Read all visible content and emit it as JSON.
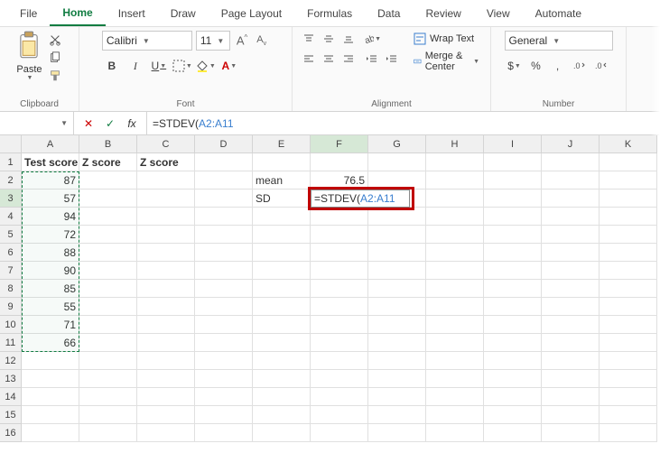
{
  "tabs": {
    "items": [
      "File",
      "Home",
      "Insert",
      "Draw",
      "Page Layout",
      "Formulas",
      "Data",
      "Review",
      "View",
      "Automate"
    ],
    "active_index": 1
  },
  "ribbon": {
    "clipboard": {
      "label": "Clipboard",
      "paste": "Paste"
    },
    "font": {
      "label": "Font",
      "name": "Calibri",
      "size": "11",
      "increase": "A",
      "decrease": "A",
      "bold": "B",
      "italic": "I",
      "underline": "U"
    },
    "alignment": {
      "label": "Alignment",
      "wrap": "Wrap Text",
      "merge": "Merge & Center"
    },
    "number": {
      "label": "Number",
      "format": "General",
      "currency": "$",
      "percent": "%",
      "comma": ","
    }
  },
  "formula_bar": {
    "name_box": "",
    "formula_prefix": "=STDEV(",
    "formula_ref": "A2:A11"
  },
  "columns": [
    "A",
    "B",
    "C",
    "D",
    "E",
    "F",
    "G",
    "H",
    "I",
    "J",
    "K"
  ],
  "rows": [
    "1",
    "2",
    "3",
    "4",
    "5",
    "6",
    "7",
    "8",
    "9",
    "10",
    "11",
    "12",
    "13",
    "14",
    "15",
    "16"
  ],
  "data": {
    "A1": "Test score",
    "B1": "Z score",
    "C1": "Z score",
    "A2": "87",
    "A3": "57",
    "A4": "94",
    "A5": "72",
    "A6": "88",
    "A7": "90",
    "A8": "85",
    "A9": "55",
    "A10": "71",
    "A11": "66",
    "E2": "mean",
    "F2": "76.5",
    "E3": "SD"
  },
  "active_cell": {
    "address": "F3",
    "display_prefix": "=STDEV(",
    "display_ref": "A2:A11"
  },
  "selection_range": "A2:A11",
  "chart_data": {
    "type": "table",
    "title": "Test scores with computed mean and SD formula entry",
    "columns": [
      "Test score"
    ],
    "values": [
      87,
      57,
      94,
      72,
      88,
      90,
      85,
      55,
      71,
      66
    ],
    "derived": {
      "mean": 76.5,
      "sd_formula": "=STDEV(A2:A11)"
    }
  }
}
